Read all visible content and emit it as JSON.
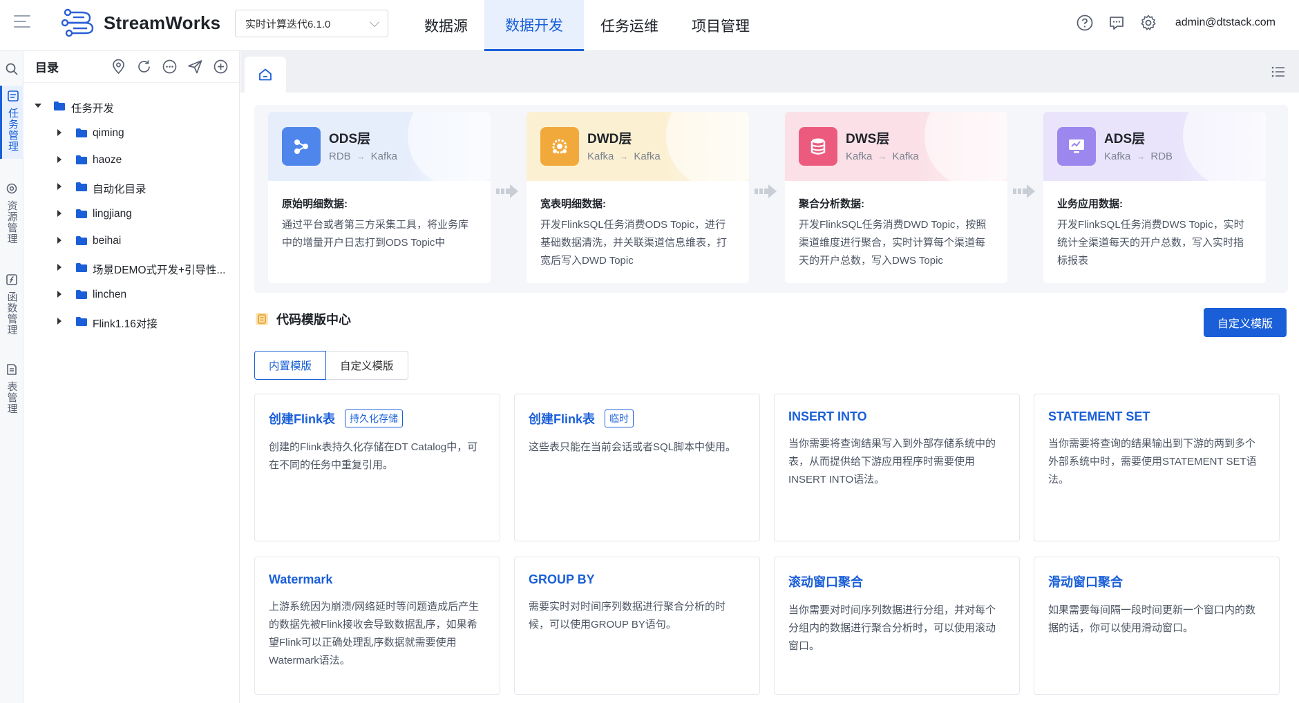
{
  "app": {
    "brand": "StreamWorks",
    "version": "实时计算迭代6.1.0"
  },
  "nav": [
    "数据源",
    "数据开发",
    "任务运维",
    "项目管理"
  ],
  "nav_active": 1,
  "header": {
    "user": "admin@dtstack.com"
  },
  "rail": [
    "任务管理",
    "资源管理",
    "函数管理",
    "表管理"
  ],
  "catalog": {
    "title": "目录",
    "root": "任务开发",
    "items": [
      "qiming",
      "haoze",
      "自动化目录",
      "lingjiang",
      "beihai",
      "场景DEMO式开发+引导性...",
      "linchen",
      "Flink1.16对接"
    ]
  },
  "layers": [
    {
      "name": "ODS层",
      "from": "RDB",
      "to": "Kafka",
      "sub": "原始明细数据:",
      "desc": "通过平台或者第三方采集工具，将业务库中的增量开户日志打到ODS Topic中",
      "color": "#e6edfb",
      "badge": "#4f86ec"
    },
    {
      "name": "DWD层",
      "from": "Kafka",
      "to": "Kafka",
      "sub": "宽表明细数据:",
      "desc": "开发FlinkSQL任务消费ODS Topic，进行基础数据清洗，并关联渠道信息维表，打宽后写入DWD Topic",
      "color": "#fcf0d2",
      "badge": "#f2a93b"
    },
    {
      "name": "DWS层",
      "from": "Kafka",
      "to": "Kafka",
      "sub": "聚合分析数据:",
      "desc": "开发FlinkSQL任务消费DWD Topic，按照渠道维度进行聚合，实时计算每个渠道每天的开户总数，写入DWS Topic",
      "color": "#fbe1e7",
      "badge": "#ec5b7d"
    },
    {
      "name": "ADS层",
      "from": "Kafka",
      "to": "RDB",
      "sub": "业务应用数据:",
      "desc": "开发FlinkSQL任务消费DWS Topic，实时统计全渠道每天的开户总数，写入实时指标报表",
      "color": "#e9e4fb",
      "badge": "#9b87ee"
    }
  ],
  "template_center": {
    "title": "代码模版中心",
    "custom_button": "自定义模版",
    "tabs": [
      "内置模版",
      "自定义模版"
    ]
  },
  "templates": [
    {
      "title": "创建Flink表",
      "tag": "持久化存储",
      "desc": "创建的Flink表持久化存储在DT Catalog中，可在不同的任务中重复引用。"
    },
    {
      "title": "创建Flink表",
      "tag": "临时",
      "desc": "这些表只能在当前会话或者SQL脚本中使用。"
    },
    {
      "title": "INSERT INTO",
      "tag": "",
      "desc": "当你需要将查询结果写入到外部存储系统中的表，从而提供给下游应用程序时需要使用INSERT INTO语法。"
    },
    {
      "title": "STATEMENT SET",
      "tag": "",
      "desc": "当你需要将查询的结果输出到下游的两到多个外部系统中时，需要使用STATEMENT SET语法。"
    },
    {
      "title": "Watermark",
      "tag": "",
      "desc": "上游系统因为崩溃/网络延时等问题造成后产生的数据先被Flink接收会导致数据乱序，如果希望Flink可以正确处理乱序数据就需要使用Watermark语法。"
    },
    {
      "title": "GROUP BY",
      "tag": "",
      "desc": "需要实时对时间序列数据进行聚合分析的时候，可以使用GROUP BY语句。"
    },
    {
      "title": "滚动窗口聚合",
      "tag": "",
      "desc": "当你需要对时间序列数据进行分组，并对每个分组内的数据进行聚合分析时，可以使用滚动窗口。"
    },
    {
      "title": "滑动窗口聚合",
      "tag": "",
      "desc": "如果需要每间隔一段时间更新一个窗口内的数据的话，你可以使用滑动窗口。"
    }
  ]
}
